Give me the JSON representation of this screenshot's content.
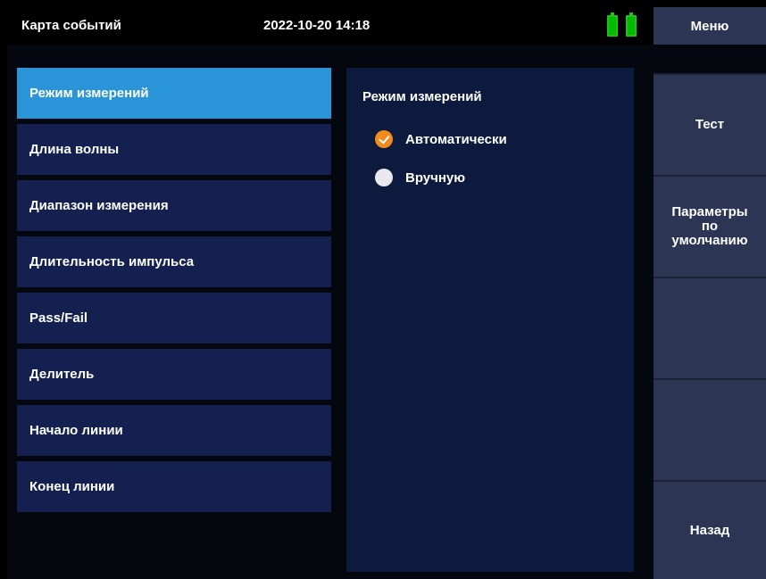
{
  "header": {
    "title": "Карта событий",
    "datetime": "2022-10-20 14:18",
    "battery_icons": [
      "battery-icon",
      "battery-icon"
    ],
    "battery_color": "#22c21b"
  },
  "menu": {
    "label": "Меню"
  },
  "settings_list": {
    "items": [
      {
        "label": "Режим измерений",
        "active": true
      },
      {
        "label": "Длина волны"
      },
      {
        "label": "Диапазон измерения"
      },
      {
        "label": "Длительность импульса"
      },
      {
        "label": "Pass/Fail"
      },
      {
        "label": "Делитель"
      },
      {
        "label": "Начало линии"
      },
      {
        "label": "Конец линии"
      }
    ],
    "active_color": "#2994d8",
    "item_color": "#14204f"
  },
  "panel": {
    "title": "Режим измерений",
    "options": [
      {
        "label": "Автоматически",
        "selected": true
      },
      {
        "label": "Вручную",
        "selected": false
      }
    ],
    "accent_color": "#f28a1d"
  },
  "softkeys": {
    "test": "Тест",
    "defaults_line1": "Параметры",
    "defaults_line2": "по",
    "defaults_line3": "умолчанию",
    "back": "Назад"
  }
}
